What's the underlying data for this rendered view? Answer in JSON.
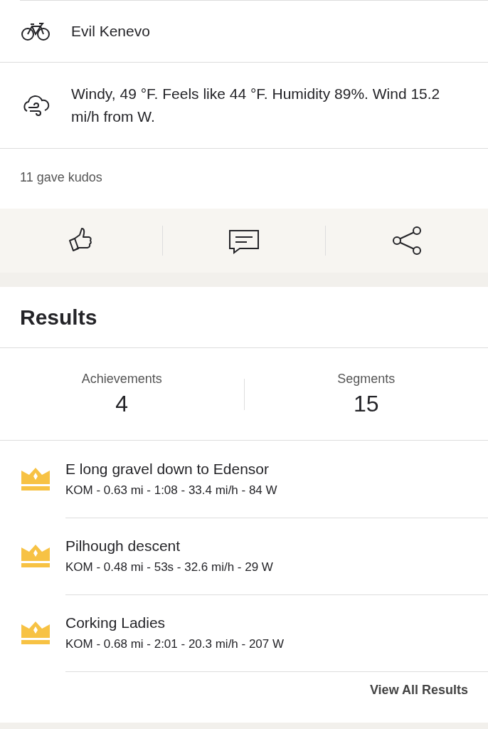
{
  "details": [
    {
      "kind": "bike",
      "text": "Evil Kenevo"
    },
    {
      "kind": "weather",
      "text": "Windy, 49 °F. Feels like 44 °F. Humidity 89%. Wind 15.2 mi/h from W."
    }
  ],
  "kudos": "11 gave kudos",
  "results": {
    "title": "Results",
    "stats": [
      {
        "label": "Achievements",
        "value": "4"
      },
      {
        "label": "Segments",
        "value": "15"
      }
    ],
    "segments": [
      {
        "name": "E long gravel down to Edensor",
        "summary": "KOM - 0.63 mi - 1:08 - 33.4 mi/h - 84 W"
      },
      {
        "name": "Pilhough descent",
        "summary": "KOM - 0.48 mi - 53s - 32.6 mi/h - 29 W"
      },
      {
        "name": "Corking Ladies",
        "summary": "KOM - 0.68 mi - 2:01 - 20.3 mi/h - 207 W"
      }
    ],
    "link": "View All Results"
  }
}
